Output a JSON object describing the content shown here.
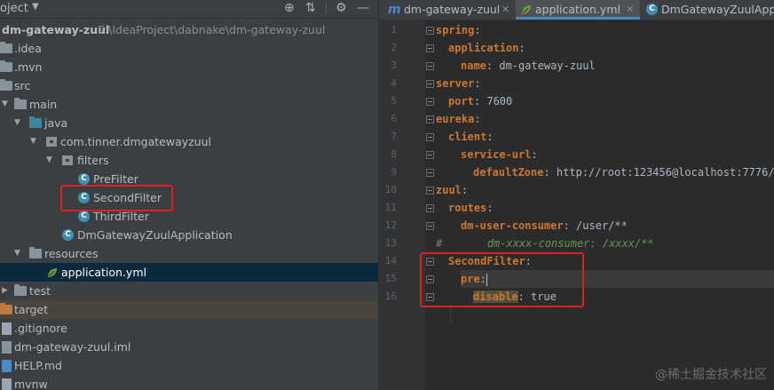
{
  "project_panel": {
    "title": "oject",
    "header_icons": [
      "target-icon",
      "collapse-icon",
      "gear-icon",
      "hide-icon"
    ],
    "tree": [
      {
        "label": "dm-gateway-zuul",
        "path": "E:\\IdeaProject\\dabnake\\dm-gateway-zuul",
        "icon": "module-folder-icon",
        "expanded": true
      },
      {
        "label": ".idea",
        "icon": "folder-icon"
      },
      {
        "label": ".mvn",
        "icon": "folder-icon"
      },
      {
        "label": "src",
        "icon": "folder-icon",
        "expanded": true
      },
      {
        "label": "main",
        "icon": "folder-icon",
        "expanded": true
      },
      {
        "label": "java",
        "icon": "source-folder-icon",
        "expanded": true
      },
      {
        "label": "com.tinner.dmgatewayzuul",
        "icon": "package-icon",
        "expanded": true
      },
      {
        "label": "filters",
        "icon": "package-icon",
        "expanded": true
      },
      {
        "label": "PreFilter",
        "icon": "class-icon"
      },
      {
        "label": "SecondFilter",
        "icon": "class-icon"
      },
      {
        "label": "ThirdFilter",
        "icon": "class-icon"
      },
      {
        "label": "DmGatewayZuulApplication",
        "icon": "spring-class-icon"
      },
      {
        "label": "resources",
        "icon": "resources-folder-icon",
        "expanded": true
      },
      {
        "label": "application.yml",
        "icon": "spring-yml-icon"
      },
      {
        "label": "test",
        "icon": "folder-icon",
        "expanded": false
      },
      {
        "label": "target",
        "icon": "excluded-folder-icon",
        "expanded": false
      },
      {
        "label": ".gitignore",
        "icon": "file-icon"
      },
      {
        "label": "dm-gateway-zuul.iml",
        "icon": "iml-file-icon"
      },
      {
        "label": "HELP.md",
        "icon": "markdown-file-icon"
      },
      {
        "label": "mvnw",
        "icon": "file-icon"
      }
    ]
  },
  "editor": {
    "tabs": [
      {
        "label": "dm-gateway-zuul",
        "icon": "maven-icon"
      },
      {
        "label": "application.yml",
        "icon": "spring-yml-icon",
        "active": true
      },
      {
        "label": "DmGatewayZuulApplica",
        "icon": "spring-class-icon"
      }
    ],
    "lines": [
      {
        "n": "1",
        "key": "spring",
        "rest": ":"
      },
      {
        "n": "2",
        "key": "application",
        "rest": ":"
      },
      {
        "n": "3",
        "key": "name",
        "rest": ": dm-gateway-zuul"
      },
      {
        "n": "4",
        "key": "server",
        "rest": ":"
      },
      {
        "n": "5",
        "key": "port",
        "rest": ": 7600"
      },
      {
        "n": "6",
        "key": "eureka",
        "rest": ":"
      },
      {
        "n": "7",
        "key": "client",
        "rest": ":"
      },
      {
        "n": "8",
        "key": "service-url",
        "rest": ":"
      },
      {
        "n": "9",
        "key": "defaultZone",
        "rest": ": http://root:123456@localhost:7776/"
      },
      {
        "n": "10",
        "key": "zuul",
        "rest": ":"
      },
      {
        "n": "11",
        "key": "routes",
        "rest": ":"
      },
      {
        "n": "12",
        "key": "dm-user-consumer",
        "rest": ": /user/**"
      },
      {
        "n": "13",
        "comment_hash": "#",
        "comment_key": "dm-xxxx-consumer",
        "comment_rest": ": /xxxx/**"
      },
      {
        "n": "14",
        "key": "SecondFilter",
        "rest": ":"
      },
      {
        "n": "15",
        "key": "pre",
        "rest": ":"
      },
      {
        "n": "16",
        "key": "disable",
        "rest": ": true"
      }
    ]
  },
  "watermark": "@稀土掘金技术社区"
}
